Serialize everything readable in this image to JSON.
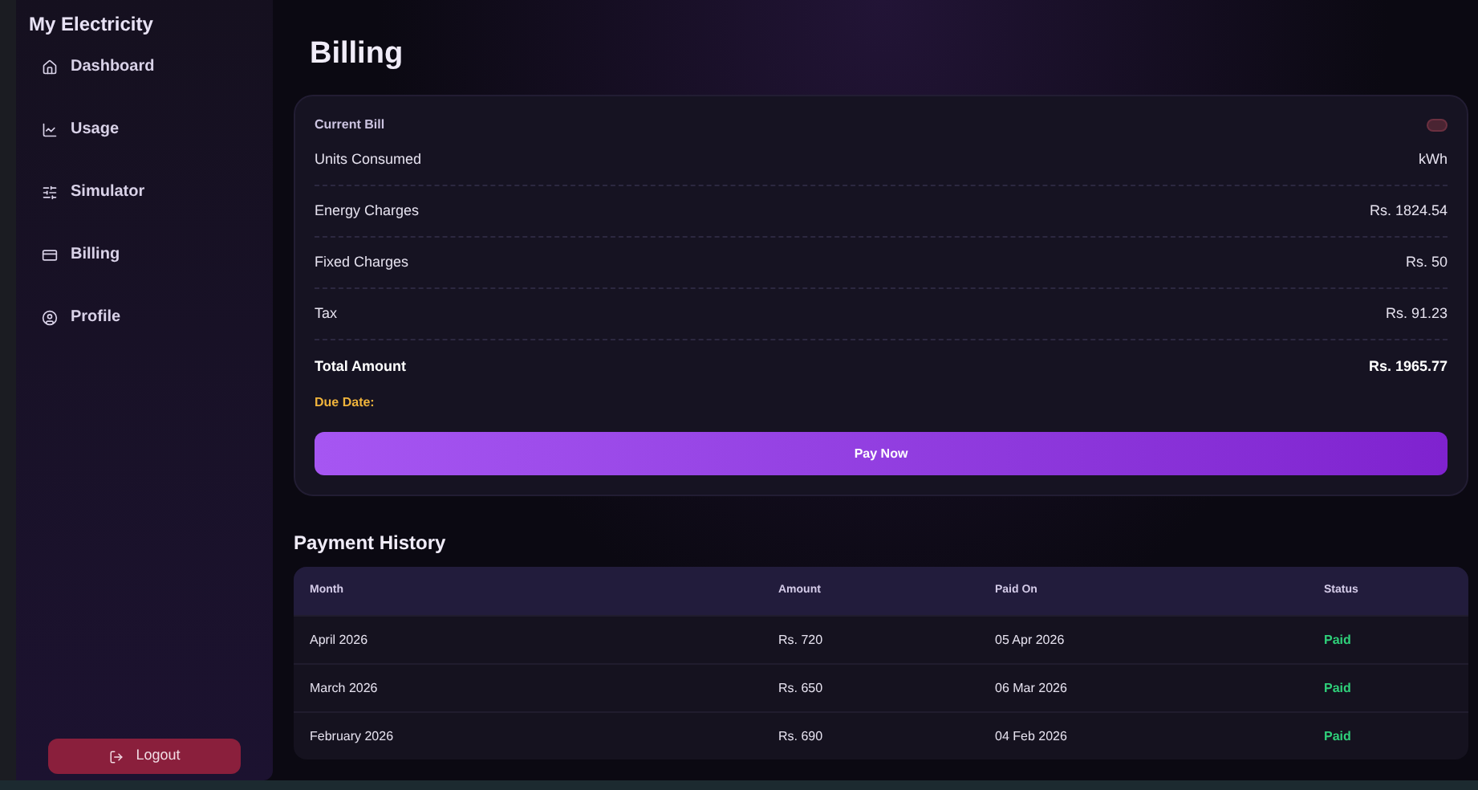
{
  "sidebar": {
    "title": "My Electricity",
    "items": [
      {
        "label": "Dashboard",
        "selected": false
      },
      {
        "label": "Usage",
        "selected": false
      },
      {
        "label": "Simulator",
        "selected": false
      },
      {
        "label": "Billing",
        "selected": false
      },
      {
        "label": "Profile",
        "selected": false
      }
    ],
    "logout": "Logout"
  },
  "page_title": "Billing",
  "current_bill": {
    "title": "Current Bill",
    "rows": [
      {
        "label": "Units Consumed",
        "value": "kWh"
      },
      {
        "label": "Energy Charges",
        "value": "Rs. 1824.54"
      },
      {
        "label": "Fixed Charges",
        "value": "Rs. 50"
      },
      {
        "label": "Tax",
        "value": "Rs. 91.23"
      }
    ],
    "total": {
      "label": "Total Amount",
      "value": "Rs. 1965.77"
    },
    "due_date": "Due Date:",
    "pay_button": "Pay Now"
  },
  "payment_history": {
    "title": "Payment History",
    "columns": [
      "Month",
      "Amount",
      "Paid On",
      "Status"
    ],
    "rows": [
      {
        "month": "April 2026",
        "amount": "Rs. 720",
        "paid_on": "05 Apr 2026",
        "status": "Paid"
      },
      {
        "month": "March 2026",
        "amount": "Rs. 650",
        "paid_on": "06 Mar 2026",
        "status": "Paid"
      },
      {
        "month": "February 2026",
        "amount": "Rs. 690",
        "paid_on": "04 Feb 2026",
        "status": "Paid"
      }
    ]
  }
}
